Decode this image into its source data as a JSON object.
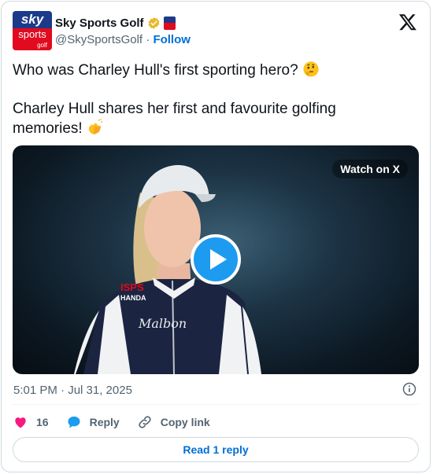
{
  "account": {
    "display_name": "Sky Sports Golf",
    "handle": "@SkySportsGolf",
    "separator": "·",
    "follow_label": "Follow",
    "avatar_text_top": "sky",
    "avatar_text_mid": "sports",
    "avatar_text_bottom": "golf",
    "verified_color": "#e8b829"
  },
  "tweet": {
    "line1": "Who was Charley Hull's first sporting hero?",
    "line1_emoji": "thinking-face",
    "line2": "Charley Hull shares her first and favourite golfing memories!",
    "line2_emoji": "clapping-hands"
  },
  "video": {
    "watch_label": "Watch on X",
    "player_icon": "play-icon",
    "shirt_sponsor_1": "ISPS",
    "shirt_sponsor_2": "HANDA",
    "shirt_brand": "Malbon"
  },
  "meta": {
    "timestamp": "5:01 PM · Jul 31, 2025"
  },
  "actions": {
    "likes_count": "16",
    "reply_label": "Reply",
    "copy_link_label": "Copy link"
  },
  "footer": {
    "read_reply_label": "Read 1 reply"
  },
  "colors": {
    "like": "#f91880",
    "reply_bubble": "#1d9bf0",
    "link": "#006fd6",
    "secondary_text": "#536471"
  }
}
